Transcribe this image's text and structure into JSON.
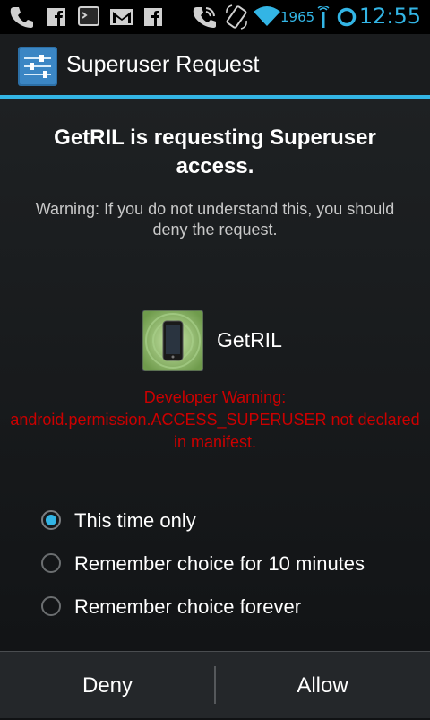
{
  "status_bar": {
    "count": "1965",
    "clock": "12:55",
    "icons": [
      "phone-icon",
      "facebook-icon",
      "terminal-icon",
      "gmail-icon",
      "facebook-icon",
      "phone-call-icon",
      "rotation-icon",
      "wifi-icon",
      "signal-icon",
      "ring-icon"
    ]
  },
  "action_bar": {
    "title": "Superuser Request",
    "accent_color": "#33b5e5"
  },
  "request": {
    "title": "GetRIL is requesting Superuser access.",
    "warning": "Warning: If you do not understand this, you should deny the request.",
    "app_name": "GetRIL",
    "developer_warning": "Developer Warning: android.permission.ACCESS_SUPERUSER not declared in manifest.",
    "developer_warning_color": "#cc0000"
  },
  "options": [
    {
      "label": "This time only",
      "selected": true
    },
    {
      "label": "Remember choice for 10 minutes",
      "selected": false
    },
    {
      "label": "Remember choice forever",
      "selected": false
    }
  ],
  "buttons": {
    "deny": "Deny",
    "allow": "Allow"
  }
}
